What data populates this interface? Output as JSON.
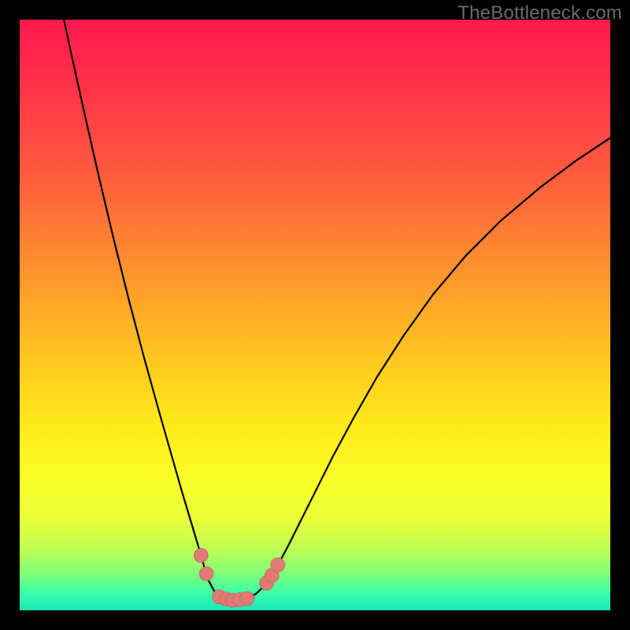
{
  "watermark": "TheBottleneck.com",
  "chart_data": {
    "type": "line",
    "title": "",
    "xlabel": "",
    "ylabel": "",
    "xlim": [
      0,
      100
    ],
    "ylim": [
      0,
      100
    ],
    "grid": false,
    "legend": false,
    "curve_points": [
      {
        "x": 7.5,
        "y": 100.0
      },
      {
        "x": 9.0,
        "y": 93.0
      },
      {
        "x": 11.0,
        "y": 84.0
      },
      {
        "x": 13.5,
        "y": 73.0
      },
      {
        "x": 16.0,
        "y": 62.5
      },
      {
        "x": 18.5,
        "y": 52.5
      },
      {
        "x": 21.0,
        "y": 43.0
      },
      {
        "x": 23.5,
        "y": 34.0
      },
      {
        "x": 25.5,
        "y": 27.0
      },
      {
        "x": 27.5,
        "y": 20.0
      },
      {
        "x": 29.0,
        "y": 15.0
      },
      {
        "x": 30.2,
        "y": 11.0
      },
      {
        "x": 31.2,
        "y": 7.5
      },
      {
        "x": 32.0,
        "y": 5.0
      },
      {
        "x": 32.8,
        "y": 3.5
      },
      {
        "x": 33.5,
        "y": 2.5
      },
      {
        "x": 34.3,
        "y": 2.0
      },
      {
        "x": 35.2,
        "y": 1.8
      },
      {
        "x": 36.3,
        "y": 1.7
      },
      {
        "x": 37.5,
        "y": 1.8
      },
      {
        "x": 38.7,
        "y": 2.1
      },
      {
        "x": 40.0,
        "y": 2.8
      },
      {
        "x": 41.3,
        "y": 4.0
      },
      {
        "x": 42.6,
        "y": 5.8
      },
      {
        "x": 44.0,
        "y": 8.2
      },
      {
        "x": 45.5,
        "y": 11.0
      },
      {
        "x": 47.5,
        "y": 15.0
      },
      {
        "x": 50.0,
        "y": 20.0
      },
      {
        "x": 53.0,
        "y": 26.0
      },
      {
        "x": 56.5,
        "y": 32.5
      },
      {
        "x": 60.5,
        "y": 39.5
      },
      {
        "x": 65.0,
        "y": 46.5
      },
      {
        "x": 70.0,
        "y": 53.5
      },
      {
        "x": 75.5,
        "y": 60.0
      },
      {
        "x": 81.5,
        "y": 66.0
      },
      {
        "x": 88.0,
        "y": 71.5
      },
      {
        "x": 94.0,
        "y": 76.0
      },
      {
        "x": 100.0,
        "y": 80.0
      }
    ],
    "markers": [
      {
        "x": 30.7,
        "y": 9.3
      },
      {
        "x": 31.6,
        "y": 6.2
      },
      {
        "x": 33.8,
        "y": 2.3
      },
      {
        "x": 35.0,
        "y": 1.9
      },
      {
        "x": 36.1,
        "y": 1.7
      },
      {
        "x": 37.3,
        "y": 1.8
      },
      {
        "x": 38.5,
        "y": 2.0
      },
      {
        "x": 41.8,
        "y": 4.6
      },
      {
        "x": 42.7,
        "y": 5.9
      },
      {
        "x": 43.7,
        "y": 7.7
      }
    ],
    "marker_radius": 1.2
  }
}
